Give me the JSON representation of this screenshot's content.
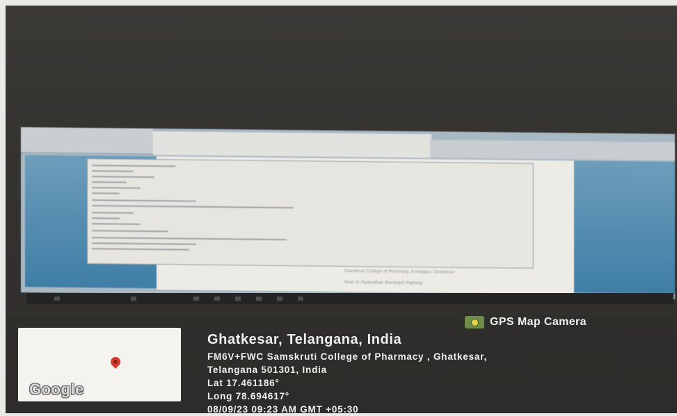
{
  "document": {
    "line1": "Samskruti College of Pharmacy, Kondapur, Ghatkesar",
    "line2": "Near to Hyderabad Warangal Highway"
  },
  "gps_badge": {
    "label": "GPS Map Camera",
    "icon": "map-camera-icon",
    "icon_color": "#6f8d4a"
  },
  "location": {
    "title": "Ghatkesar, Telangana, India",
    "address_line1": "FM6V+FWC Samskruti College of Pharmacy , Ghatkesar,",
    "address_line2": "Telangana 501301, India",
    "lat": "Lat 17.461186°",
    "long": "Long 78.694617°",
    "datetime": "08/09/23 09:23 AM GMT +05:30"
  },
  "map": {
    "logo_text": "Google",
    "pin_color": "#d23b2e"
  }
}
